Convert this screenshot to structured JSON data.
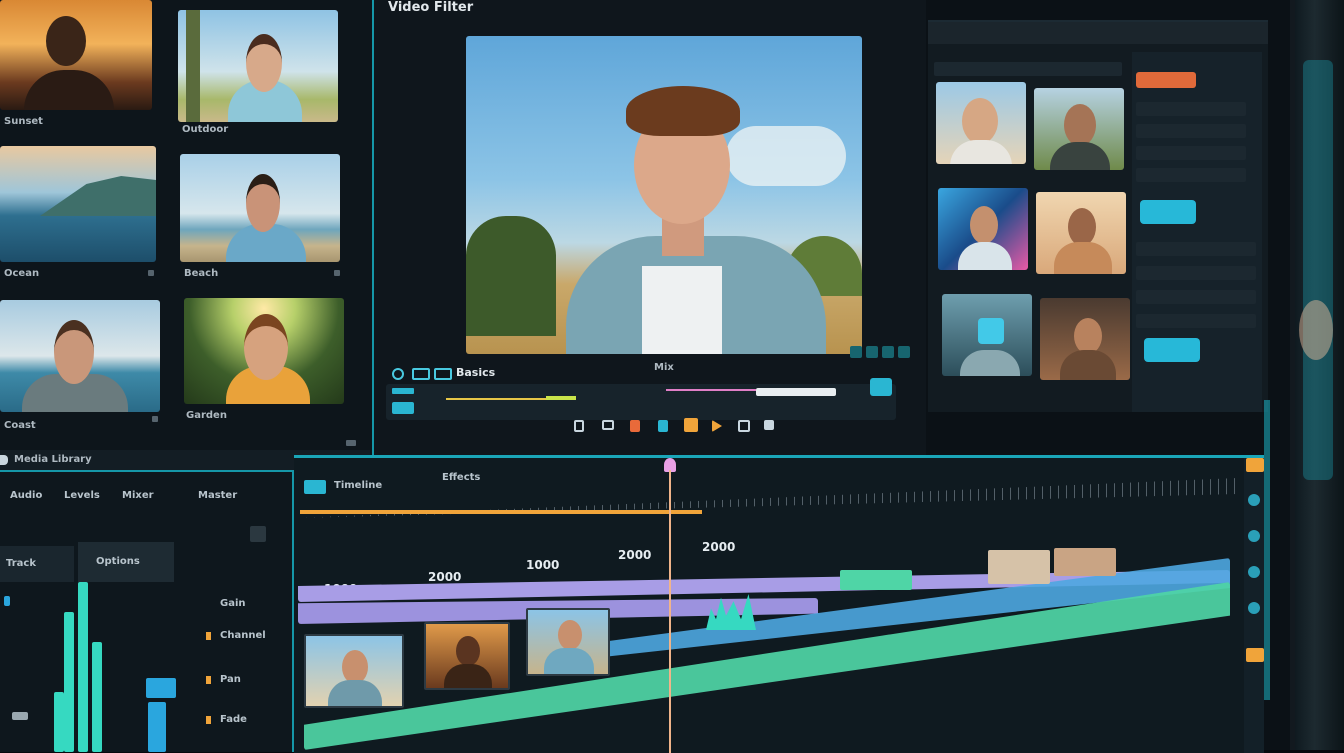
{
  "viewer": {
    "title": "Video Filter",
    "controls_label": "Basics",
    "timecode_label": "Mix"
  },
  "media_bin": {
    "items": [
      {
        "label": "Sunset"
      },
      {
        "label": "Outdoor"
      },
      {
        "label": "Ocean"
      },
      {
        "label": "Beach"
      },
      {
        "label": "Coast"
      },
      {
        "label": "Garden"
      }
    ],
    "footer_label": "Media Library"
  },
  "timeline": {
    "header_left": "Timeline",
    "header_mid": "Effects",
    "ruler": [
      "1000",
      "2000",
      "1000",
      "2000",
      "2000"
    ]
  },
  "audio_panel": {
    "tabs": [
      "Audio",
      "Levels",
      "Mixer",
      "Master"
    ],
    "mode_tabs": [
      "Track",
      "Options"
    ],
    "rows": [
      "Gain",
      "Channel",
      "Pan",
      "Fade"
    ]
  },
  "colors": {
    "accent": "#1aa6b8",
    "playhead": "#e9a0e6",
    "track_purple": "#a89de6",
    "track_blue": "#4ea7e0",
    "track_green": "#4fd5a6"
  }
}
